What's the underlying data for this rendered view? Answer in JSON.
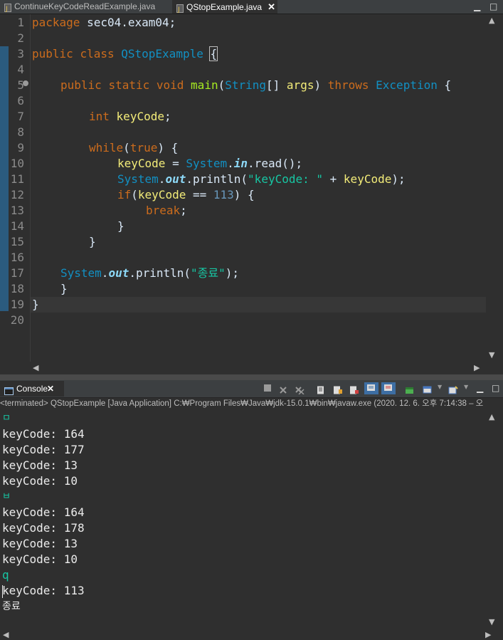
{
  "editor_tabs": [
    {
      "label": "ContinueKeyCodeReadExample.java",
      "active": false
    },
    {
      "label": "QStopExample.java",
      "active": true,
      "close": "✕"
    }
  ],
  "window_controls": {
    "minimize": "▁",
    "maximize": "□"
  },
  "line_numbers": [
    "1",
    "2",
    "3",
    "4",
    "5",
    "6",
    "7",
    "8",
    "9",
    "10",
    "11",
    "12",
    "13",
    "14",
    "15",
    "16",
    "17",
    "18",
    "19",
    "20"
  ],
  "code": {
    "l1": [
      "package",
      " sec04.exam04;"
    ],
    "l3": [
      "public",
      " ",
      "class",
      " ",
      "QStopExample",
      " ",
      "{"
    ],
    "l5": [
      "public",
      " ",
      "static",
      " ",
      "void",
      " ",
      "main",
      "(",
      "String",
      "[] ",
      "args",
      ") ",
      "throws",
      " ",
      "Exception",
      " {"
    ],
    "l7": [
      "int",
      " ",
      "keyCode",
      ";"
    ],
    "l9": [
      "while",
      "(",
      "true",
      ") {"
    ],
    "l10": [
      "keyCode",
      " = ",
      "System",
      ".",
      "in",
      ".read();"
    ],
    "l11": [
      "System",
      ".",
      "out",
      ".println(",
      "\"keyCode: \"",
      " + ",
      "keyCode",
      ");"
    ],
    "l12": [
      "if",
      "(",
      "keyCode",
      " == ",
      "113",
      ") {"
    ],
    "l13": [
      "break",
      ";"
    ],
    "l14": [
      "}"
    ],
    "l15": [
      "}"
    ],
    "l17": [
      "System",
      ".",
      "out",
      ".println(",
      "\"종료\"",
      ");"
    ],
    "l18": [
      "}"
    ],
    "l19": [
      "}"
    ]
  },
  "console": {
    "tab_label": "Console",
    "tab_close": "✕",
    "status": "<terminated> QStopExample [Java Application] C:₩Program Files₩Java₩jdk-15.0.1₩bin₩javaw.exe  (2020. 12. 6. 오후 7:14:38 – 오",
    "lines": [
      {
        "text": "ㅁ",
        "type": "input"
      },
      {
        "text": "keyCode: 164",
        "type": "output"
      },
      {
        "text": "keyCode: 177",
        "type": "output"
      },
      {
        "text": "keyCode: 13",
        "type": "output"
      },
      {
        "text": "keyCode: 10",
        "type": "output"
      },
      {
        "text": "ㅂ",
        "type": "input"
      },
      {
        "text": "keyCode: 164",
        "type": "output"
      },
      {
        "text": "keyCode: 178",
        "type": "output"
      },
      {
        "text": "keyCode: 13",
        "type": "output"
      },
      {
        "text": "keyCode: 10",
        "type": "output"
      },
      {
        "text": "q",
        "type": "input"
      },
      {
        "text": "keyCode: 113",
        "type": "output"
      },
      {
        "text": "종료",
        "type": "output"
      }
    ]
  },
  "colors": {
    "background": "#2f2f2f",
    "keyword": "#cc6c1d",
    "type": "#1290c3",
    "method": "#a7ec21",
    "variable": "#f3ec79",
    "string": "#17c6a3",
    "field": "#8dd9f8"
  }
}
